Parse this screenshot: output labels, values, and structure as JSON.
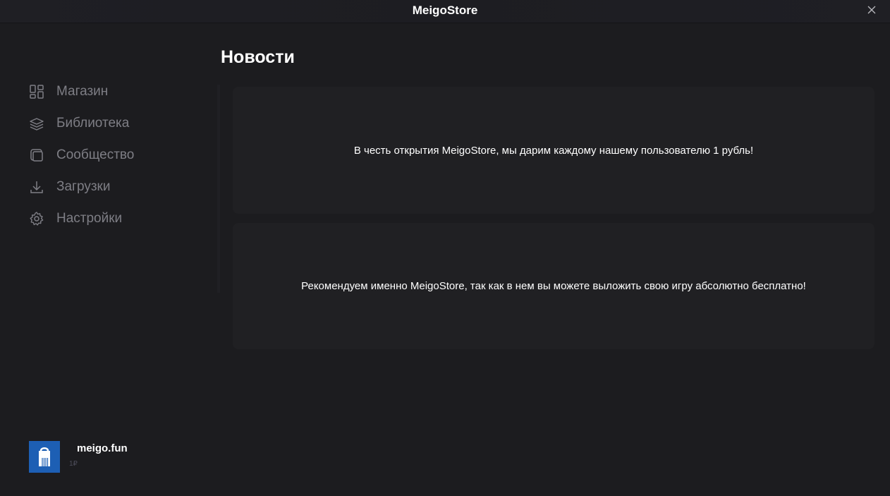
{
  "window": {
    "title": "MeigoStore"
  },
  "sidebar": {
    "items": [
      {
        "label": "Магазин",
        "icon": "store-grid-icon"
      },
      {
        "label": "Библиотека",
        "icon": "library-stack-icon"
      },
      {
        "label": "Сообщество",
        "icon": "community-cards-icon"
      },
      {
        "label": "Загрузки",
        "icon": "download-icon"
      },
      {
        "label": "Настройки",
        "icon": "gear-icon"
      }
    ]
  },
  "user": {
    "name": "meigo.fun",
    "balance": "1₽"
  },
  "main": {
    "title": "Новости",
    "news": [
      {
        "text": "В честь открытия MeigoStore, мы дарим каждому нашему пользователю 1 рубль!"
      },
      {
        "text": "Рекомендуем именно MeigoStore, так как в нем вы можете выложить свою игру абсолютно бесплатно!"
      }
    ]
  },
  "colors": {
    "background": "#1c1c1f",
    "card": "#202023",
    "nav_text": "#7e7e85",
    "avatar": "#1d5fb4"
  }
}
